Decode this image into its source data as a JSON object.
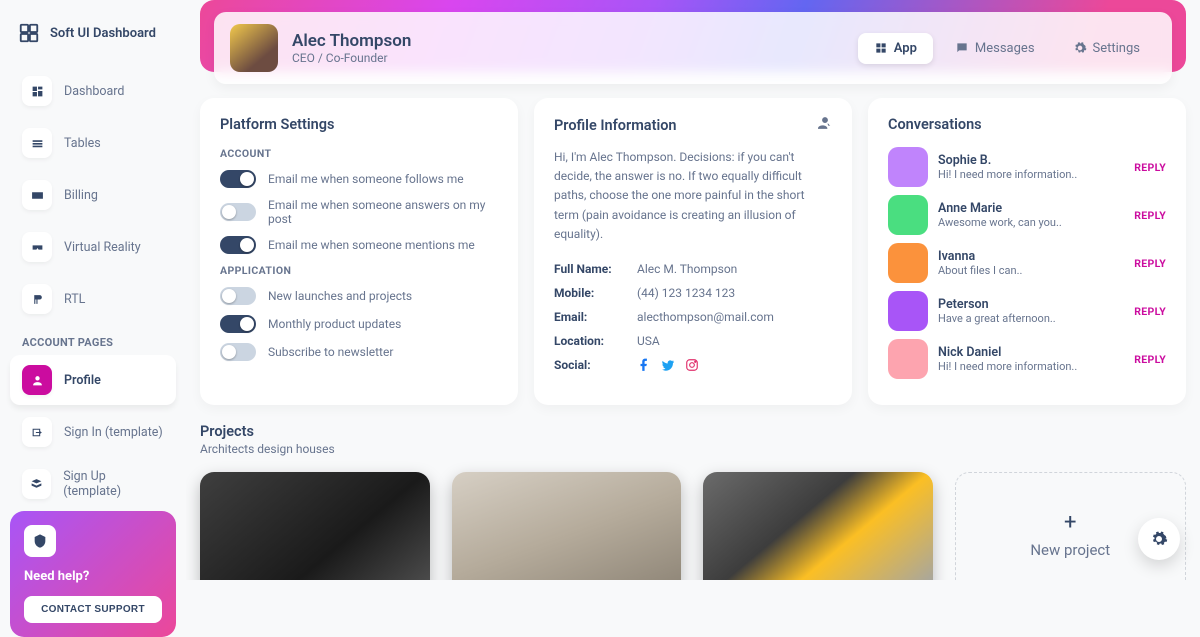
{
  "brand": "Soft UI Dashboard",
  "sidebar": {
    "nav": [
      {
        "label": "Dashboard",
        "icon": "dashboard-icon"
      },
      {
        "label": "Tables",
        "icon": "tables-icon"
      },
      {
        "label": "Billing",
        "icon": "billing-icon"
      },
      {
        "label": "Virtual Reality",
        "icon": "vr-icon"
      },
      {
        "label": "RTL",
        "icon": "rtl-icon"
      }
    ],
    "account_section": "ACCOUNT PAGES",
    "account_nav": [
      {
        "label": "Profile",
        "icon": "profile-icon",
        "active": true
      },
      {
        "label": "Sign In (template)",
        "icon": "signin-icon"
      },
      {
        "label": "Sign Up (template)",
        "icon": "signup-icon"
      }
    ],
    "help": {
      "title": "Need help?",
      "button": "CONTACT SUPPORT"
    }
  },
  "profile": {
    "name": "Alec Thompson",
    "role": "CEO / Co-Founder"
  },
  "tabs": [
    {
      "label": "App",
      "icon": "app-icon",
      "active": true
    },
    {
      "label": "Messages",
      "icon": "messages-icon"
    },
    {
      "label": "Settings",
      "icon": "settings-icon"
    }
  ],
  "settings": {
    "title": "Platform Settings",
    "section_account": "ACCOUNT",
    "section_application": "APPLICATION",
    "toggles_account": [
      {
        "label": "Email me when someone follows me",
        "on": true
      },
      {
        "label": "Email me when someone answers on my post",
        "on": false
      },
      {
        "label": "Email me when someone mentions me",
        "on": true
      }
    ],
    "toggles_app": [
      {
        "label": "New launches and projects",
        "on": false
      },
      {
        "label": "Monthly product updates",
        "on": true
      },
      {
        "label": "Subscribe to newsletter",
        "on": false
      }
    ]
  },
  "info": {
    "title": "Profile Information",
    "bio": "Hi, I'm Alec Thompson. Decisions: if you can't decide, the answer is no. If two equally difficult paths, choose the one more painful in the short term (pain avoidance is creating an illusion of equality).",
    "labels": {
      "name": "Full Name:",
      "mobile": "Mobile:",
      "email": "Email:",
      "location": "Location:",
      "social": "Social:"
    },
    "name": "Alec M. Thompson",
    "mobile": "(44) 123 1234 123",
    "email": "alecthompson@mail.com",
    "location": "USA"
  },
  "conversations": {
    "title": "Conversations",
    "reply": "REPLY",
    "items": [
      {
        "name": "Sophie B.",
        "msg": "Hi! I need more information..",
        "color": "#c084fc"
      },
      {
        "name": "Anne Marie",
        "msg": "Awesome work, can you..",
        "color": "#4ade80"
      },
      {
        "name": "Ivanna",
        "msg": "About files I can..",
        "color": "#fb923c"
      },
      {
        "name": "Peterson",
        "msg": "Have a great afternoon..",
        "color": "#a855f7"
      },
      {
        "name": "Nick Daniel",
        "msg": "Hi! I need more information..",
        "color": "#fda4af"
      }
    ]
  },
  "projects": {
    "title": "Projects",
    "subtitle": "Architects design houses",
    "new_label": "New project",
    "cards": [
      {
        "bg": "linear-gradient(140deg,#3f3f3f 0%,#1a1a1a 60%,#525252 100%)"
      },
      {
        "bg": "linear-gradient(160deg,#d6cfc4 0%,#b5ab9b 50%,#8b8274 100%)"
      },
      {
        "bg": "linear-gradient(140deg,#6b6b6b 0%,#3d3d3d 40%,#fbbf24 60%,#9ca3af 100%)"
      }
    ]
  }
}
